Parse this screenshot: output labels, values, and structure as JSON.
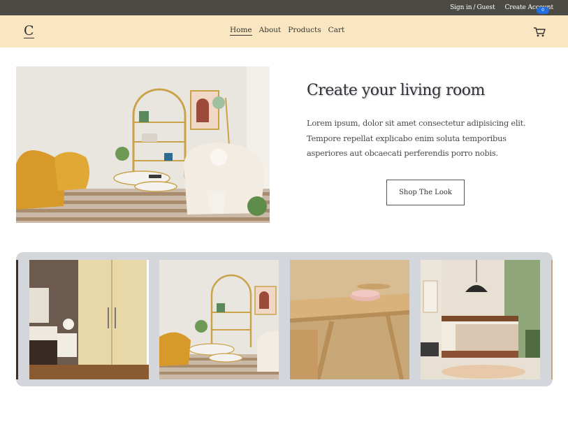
{
  "topbar": {
    "sign_in": "Sign in",
    "separator": "/",
    "guest": "Guest",
    "create_account": "Create Account"
  },
  "nav": {
    "logo": "C",
    "links": [
      "Home",
      "About",
      "Products",
      "Cart"
    ],
    "active_link": "Home",
    "cart_count": "0"
  },
  "hero": {
    "title": "Create your living room",
    "text": "Lorem ipsum, dolor sit amet consectetur adipisicing elit. Tempore repellat explicabo enim soluta temporibus asperiores aut obcaecati perferendis porro nobis.",
    "button_label": "Shop The Look"
  },
  "carousel": {
    "slides": [
      "bedroom-wardrobe-photo",
      "living-room-shelf-photo",
      "wooden-dining-table-photo",
      "green-wall-bedroom-photo"
    ]
  },
  "colors": {
    "topbar_bg": "#4b4a44",
    "navbar_bg": "#fbe6c2",
    "carousel_bg": "#d3d6db",
    "badge": "#1f6fe0"
  }
}
